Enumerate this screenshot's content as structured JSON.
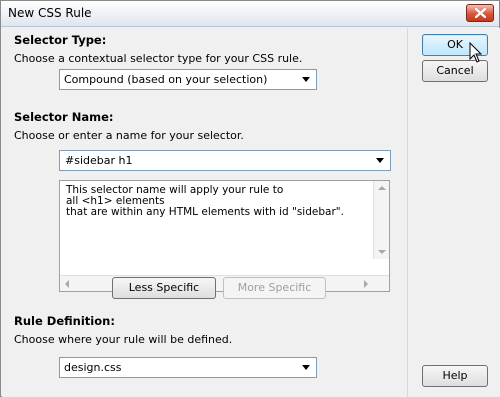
{
  "window": {
    "title": "New CSS Rule"
  },
  "selector_type": {
    "heading": "Selector Type:",
    "description": "Choose a contextual selector type for your CSS rule.",
    "selected": "Compound (based on your selection)"
  },
  "selector_name": {
    "heading": "Selector Name:",
    "description": "Choose or enter a name for your selector.",
    "value": "#sidebar h1",
    "explanation": "This selector name will apply your rule to\nall <h1> elements\nthat are within any HTML elements with id \"sidebar\"."
  },
  "specificity": {
    "less_label": "Less Specific",
    "more_label": "More Specific"
  },
  "rule_definition": {
    "heading": "Rule Definition:",
    "description": "Choose where your rule will be defined.",
    "selected": "design.css"
  },
  "buttons": {
    "ok": "OK",
    "cancel": "Cancel",
    "help": "Help"
  },
  "icons": {
    "close": "close-icon",
    "dropdown": "chevron-down-icon",
    "cursor": "mouse-pointer-icon"
  },
  "colors": {
    "close_button": "#d8553b",
    "ok_border": "#3c7fb1"
  }
}
